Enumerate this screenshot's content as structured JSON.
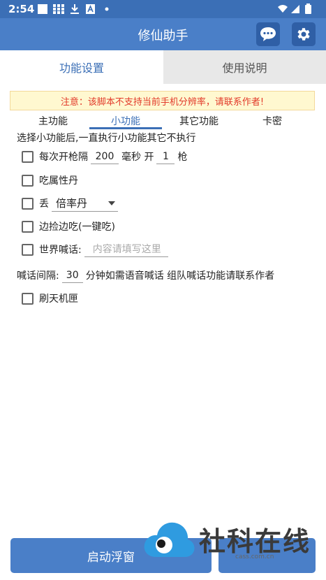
{
  "status": {
    "time": "2:54"
  },
  "app": {
    "title": "修仙助手"
  },
  "tabs": [
    {
      "label": "功能设置",
      "active": true
    },
    {
      "label": "使用说明",
      "active": false
    }
  ],
  "notice": "注意：该脚本不支持当前手机分辨率，请联系作者!",
  "subtabs": [
    {
      "label": "主功能"
    },
    {
      "label": "小功能",
      "active": true
    },
    {
      "label": "其它功能"
    },
    {
      "label": "卡密"
    }
  ],
  "intro": "选择小功能后,一直执行小功能其它不执行",
  "options": {
    "shoot": {
      "label_before": "每次开枪隔",
      "interval": "200",
      "unit": "毫秒 开",
      "count": "1",
      "suffix": "枪",
      "checked": false
    },
    "eat_attr": {
      "label": "吃属性丹",
      "checked": false
    },
    "discard": {
      "label": "丢",
      "selected": "倍率丹",
      "checked": false
    },
    "pickup": {
      "label": "边捡边吃(一键吃)",
      "checked": false
    },
    "world_chat": {
      "label": "世界喊话:",
      "placeholder": "内容请填写这里",
      "checked": false
    },
    "chat_interval": {
      "label_before": "喊话间隔:",
      "value": "30",
      "label_after": "分钟如需语音喊话 组队喊话功能请联系作者"
    },
    "heaven_box": {
      "label": "刷天机匣",
      "checked": false
    }
  },
  "bottom": {
    "start_label": "启动浮窗"
  },
  "watermark": {
    "text": "社科在线",
    "url": "cass.com.cn"
  },
  "colors": {
    "primary": "#4a7fc8",
    "statusbar": "#3b6fb6",
    "notice_text": "#e23a2a",
    "notice_bg": "#fff8d0"
  }
}
